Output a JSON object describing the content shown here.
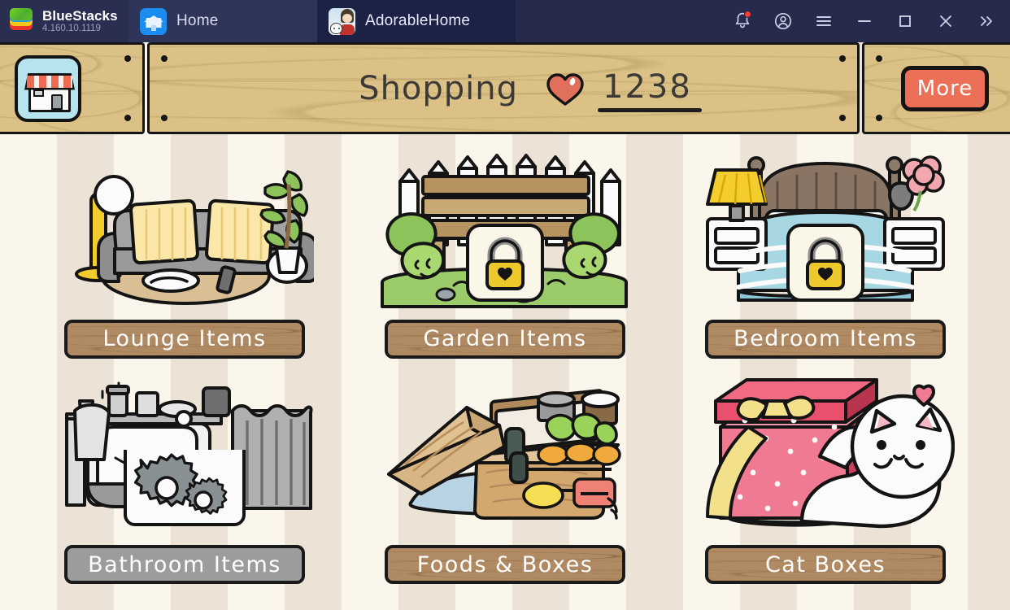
{
  "titlebar": {
    "brand": "BlueStacks",
    "version": "4.160.10.1119",
    "tabs": [
      {
        "label": "Home",
        "icon": "home-icon",
        "active": false
      },
      {
        "label": "AdorableHome",
        "icon": "game-avatar-icon",
        "active": true
      }
    ],
    "controls": [
      {
        "name": "notifications-button",
        "icon": "bell-icon",
        "badge": true
      },
      {
        "name": "account-button",
        "icon": "account-circle-icon"
      },
      {
        "name": "menu-button",
        "icon": "hamburger-icon"
      },
      {
        "name": "minimize-button",
        "icon": "minimize-icon"
      },
      {
        "name": "maximize-button",
        "icon": "maximize-icon"
      },
      {
        "name": "close-button",
        "icon": "close-icon"
      },
      {
        "name": "expand-button",
        "icon": "chevron-double-right-icon"
      }
    ]
  },
  "game": {
    "topbar": {
      "shop_icon": "shop-house-icon",
      "title": "Shopping",
      "currency": {
        "icon": "heart-icon",
        "value": "1238",
        "color": "#ec6f57"
      },
      "more_label": "More",
      "more_color": "#ec6f57"
    },
    "categories": [
      {
        "label": "Lounge Items",
        "state": "unlocked",
        "art": "lounge",
        "plate": "wood"
      },
      {
        "label": "Garden Items",
        "state": "locked",
        "art": "garden",
        "plate": "wood"
      },
      {
        "label": "Bedroom Items",
        "state": "locked",
        "art": "bedroom",
        "plate": "wood"
      },
      {
        "label": "Bathroom Items",
        "state": "maintenance",
        "art": "bathroom",
        "plate": "gray"
      },
      {
        "label": "Foods & Boxes",
        "state": "unlocked",
        "art": "foods",
        "plate": "wood"
      },
      {
        "label": "Cat Boxes",
        "state": "unlocked",
        "art": "catbox",
        "plate": "wood"
      }
    ]
  },
  "colors": {
    "titlebar_bg": "#262b4d",
    "active_tab_bg": "#1c2146",
    "wood_plank": "#dcc186",
    "plate_wood": "#b08a63",
    "plate_gray": "#9c9c9c",
    "accent": "#ec6f57",
    "bg_stripe_light": "#faf6ec",
    "bg_stripe_dark": "#ece3d6"
  }
}
